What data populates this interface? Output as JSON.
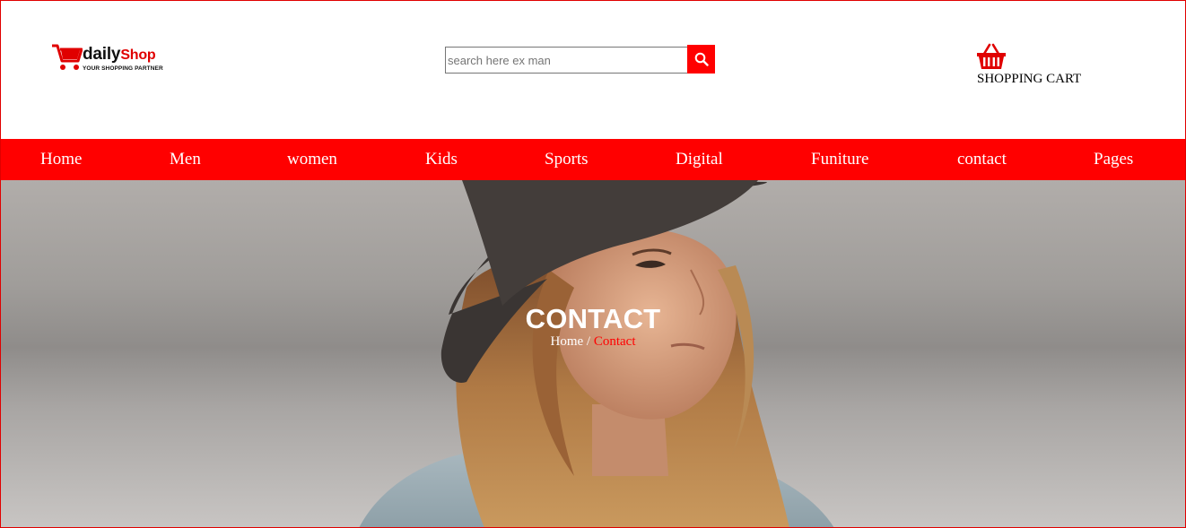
{
  "brand": {
    "name_part1": "daily",
    "name_part2": "Shop",
    "tagline": "YOUR SHOPPING PARTNER",
    "accent_color": "#ff0000"
  },
  "search": {
    "placeholder": "search here ex man",
    "value": "",
    "button_icon": "search-icon"
  },
  "cart": {
    "icon": "basket-icon",
    "label": "SHOPPING CART"
  },
  "nav": {
    "items": [
      {
        "label": "Home"
      },
      {
        "label": "Men"
      },
      {
        "label": "women"
      },
      {
        "label": "Kids"
      },
      {
        "label": "Sports"
      },
      {
        "label": "Digital"
      },
      {
        "label": "Funiture"
      },
      {
        "label": "contact"
      },
      {
        "label": "Pages"
      }
    ]
  },
  "hero": {
    "title": "CONTACT",
    "breadcrumb": {
      "home": "Home",
      "separator": " / ",
      "current": "Contact"
    }
  }
}
